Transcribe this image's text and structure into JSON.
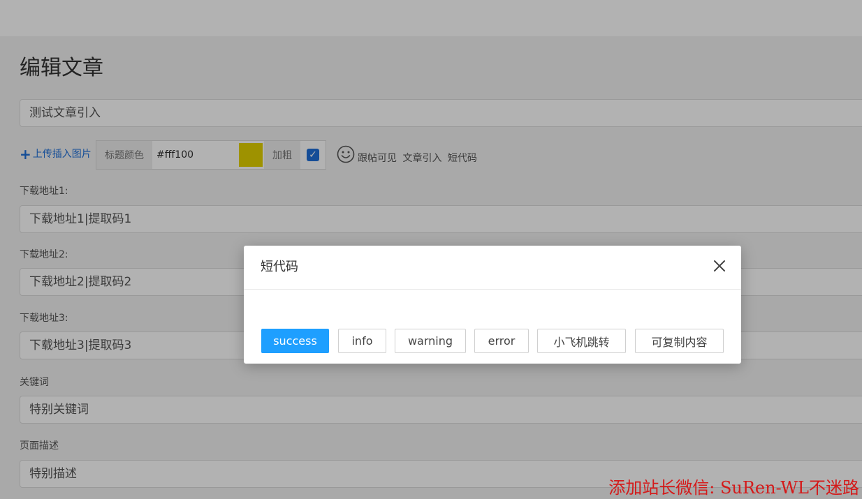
{
  "page": {
    "title": "编辑文章",
    "article_title_value": "测试文章引入"
  },
  "toolbar": {
    "upload_plus": "+",
    "upload_label": "上传插入图片",
    "title_color_label": "标题颜色",
    "title_color_value": "#fff100",
    "swatch_color": "#e3d100",
    "bold_label": "加粗",
    "bold_checked": "✓",
    "emoji_icon": "smile-icon",
    "links": [
      "跟帖可见",
      "文章引入",
      "短代码"
    ]
  },
  "fields": {
    "download1_label": "下载地址1:",
    "download1_value": "下载地址1|提取码1",
    "download2_label": "下载地址2:",
    "download2_value": "下载地址2|提取码2",
    "download3_label": "下载地址3:",
    "download3_value": "下载地址3|提取码3",
    "keywords_label": "关键词",
    "keywords_value": "特别关键词",
    "description_label": "页面描述",
    "description_value": "特别描述"
  },
  "modal": {
    "title": "短代码",
    "close_icon": "close-icon",
    "buttons": [
      "success",
      "info",
      "warning",
      "error",
      "小飞机跳转",
      "可复制内容"
    ],
    "primary_color": "#1e9fff"
  },
  "watermark": "添加站长微信: SuRen-WL不迷路"
}
